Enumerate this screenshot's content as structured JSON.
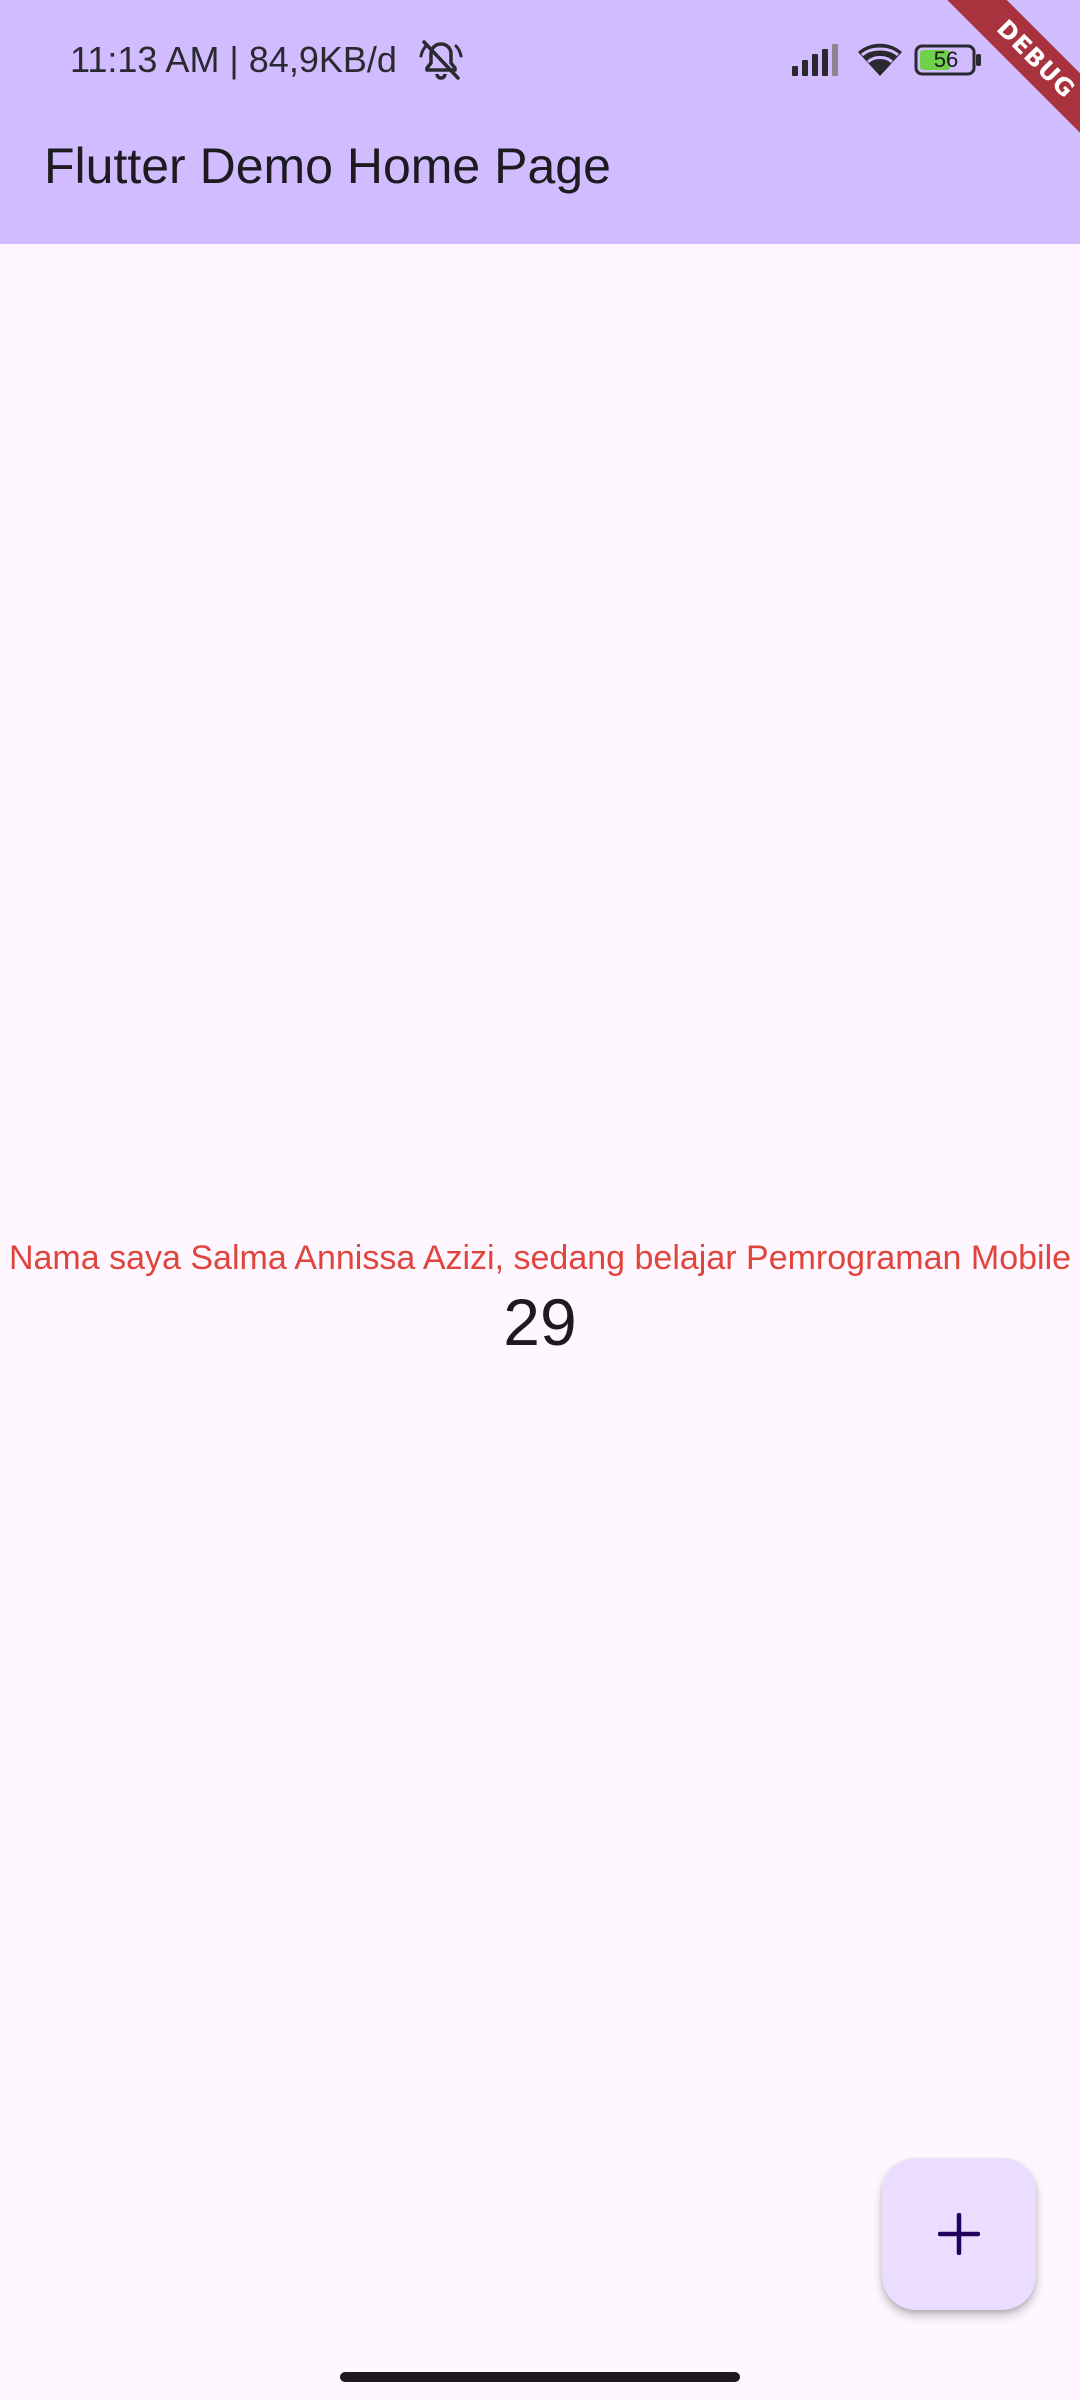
{
  "status_bar": {
    "time_text": "11:13 AM | 84,9KB/d",
    "battery_level": "56",
    "icons": [
      "mute-bell-icon",
      "signal-icon",
      "wifi-icon",
      "battery-icon"
    ]
  },
  "app_bar": {
    "title": "Flutter Demo Home Page",
    "background_color": "#d0bcff"
  },
  "debug_banner": {
    "label": "DEBUG",
    "color": "#a8323e"
  },
  "content": {
    "message": "Nama saya Salma Annissa Azizi, sedang belajar Pemrograman Mobile",
    "message_color": "#e0453d",
    "counter": "29"
  },
  "fab": {
    "icon": "plus-icon",
    "background_color": "#eaddff"
  }
}
